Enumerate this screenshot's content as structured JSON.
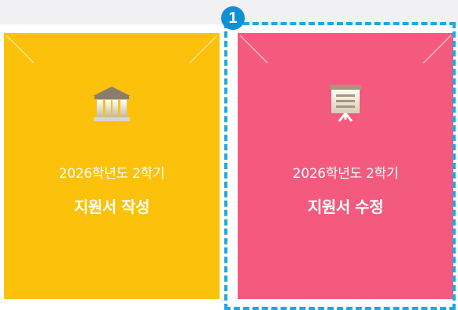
{
  "cards": [
    {
      "icon": "bank-building-icon",
      "year_label": "2026학년도 2학기",
      "title": "지원서 작성",
      "color": "#fcc10a"
    },
    {
      "icon": "presentation-board-icon",
      "year_label": "2026학년도 2학기",
      "title": "지원서 수정",
      "color": "#f45a7d"
    }
  ],
  "highlight": {
    "step_number": "1",
    "color": "#1ea7e6"
  }
}
